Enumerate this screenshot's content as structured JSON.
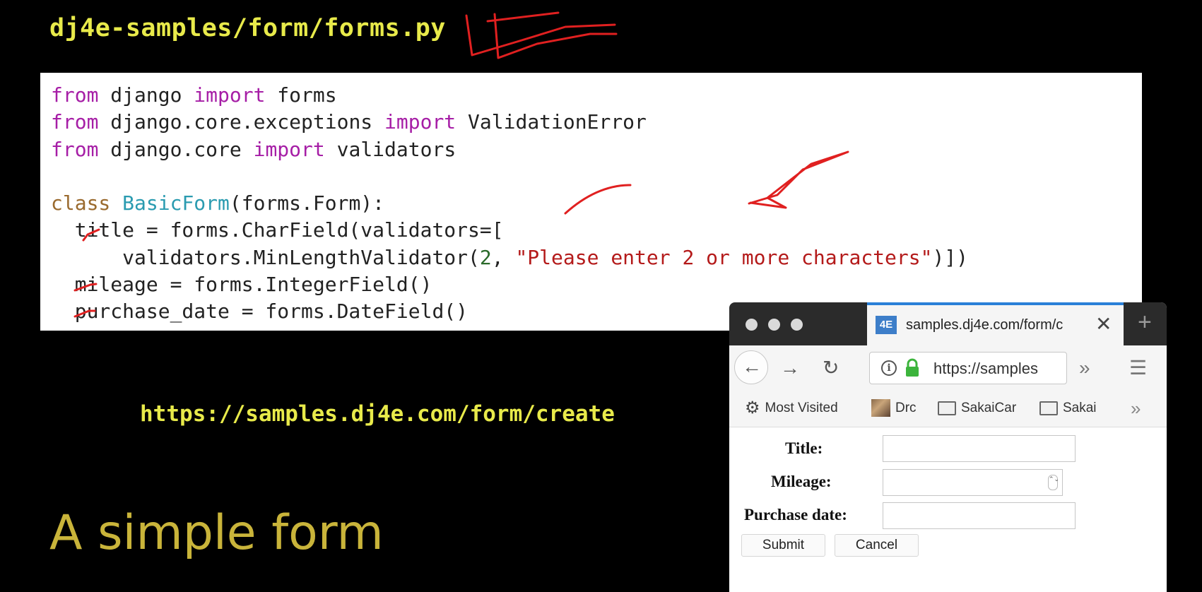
{
  "slide": {
    "path": "dj4e-samples/form/forms.py",
    "url": "https://samples.dj4e.com/form/create",
    "title": "A simple form"
  },
  "code": {
    "l1": {
      "kw1": "from",
      "t1": " django ",
      "kw2": "import",
      "t2": " forms"
    },
    "l2": {
      "kw1": "from",
      "t1": " django.core.exceptions ",
      "kw2": "import",
      "t2": " ValidationError"
    },
    "l3": {
      "kw1": "from",
      "t1": " django.core ",
      "kw2": "import",
      "t2": " validators"
    },
    "l5": {
      "kw": "class",
      "sp": " ",
      "name": "BasicForm",
      "rest": "(forms.Form):"
    },
    "l6": "  title = forms.CharField(validators=[",
    "l7": {
      "a": "      validators.MinLengthValidator(",
      "num": "2",
      "b": ", ",
      "str": "\"Please enter 2 or more characters\"",
      "c": ")])"
    },
    "l8": "  mileage = forms.IntegerField()",
    "l9": "  purchase_date = forms.DateField()"
  },
  "browser": {
    "tab_title": "samples.dj4e.com/form/c",
    "favicon": "4E",
    "close": "✕",
    "new_tab": "+",
    "back": "←",
    "forward": "→",
    "reload": "↻",
    "info": "i",
    "url": "https://samples",
    "overflow": "»",
    "menu": "☰",
    "bookmarks": {
      "gear": "⚙",
      "most_visited": "Most Visited",
      "drc": "Drc",
      "sakaicar": "SakaiCar",
      "sakai": "Sakai",
      "more": "»"
    },
    "form": {
      "title_label": "Title:",
      "mileage_label": "Mileage:",
      "purchase_date_label": "Purchase date:",
      "title_value": "",
      "mileage_value": "",
      "purchase_date_value": "",
      "spin": "⌃⌄",
      "submit": "Submit",
      "cancel": "Cancel"
    }
  },
  "colors": {
    "background": "#000000",
    "path_text": "#e8ea4a",
    "slide_title": "#c9b43a",
    "annotation": "#e02020",
    "keyword": "#a61ea6",
    "class_name": "#2a9bb0",
    "string": "#b41a1a"
  },
  "icons": [
    "info-icon",
    "lock-icon",
    "gear-icon",
    "folder-icon",
    "close-icon",
    "back-arrow-icon",
    "forward-arrow-icon",
    "reload-icon",
    "menu-icon"
  ]
}
